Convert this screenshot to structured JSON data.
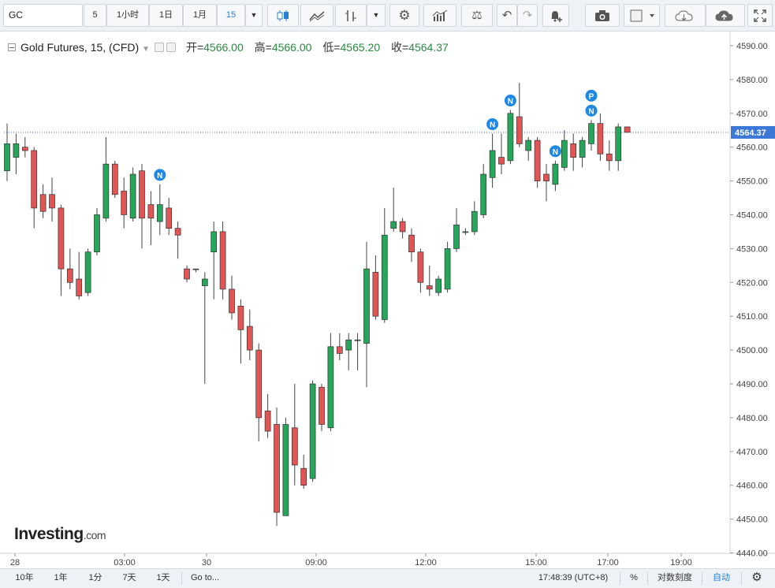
{
  "toolbar": {
    "symbol": "GC",
    "intervals": [
      "5",
      "1小时",
      "1日",
      "1月",
      "15"
    ],
    "active_interval": "15",
    "icons": [
      "dropdown-caret-icon",
      "candles-icon",
      "area-chart-icon",
      "bar-type-icon",
      "dropdown-caret-icon",
      "settings-gear-icon",
      "indicators-icon",
      "compare-scale-icon",
      "undo-icon",
      "redo-icon",
      "alert-bell-icon",
      "camera-icon",
      "color-square-icon",
      "dropdown-caret-icon",
      "cloud-download-icon",
      "cloud-upload-icon",
      "fullscreen-icon"
    ]
  },
  "legend": {
    "title": "Gold Futures, 15, (CFD)",
    "open_label": "开=",
    "open": "4566.00",
    "high_label": "高=",
    "high": "4566.00",
    "low_label": "低=",
    "low": "4565.20",
    "close_label": "收=",
    "close": "4564.37"
  },
  "price_axis": {
    "ticks": [
      "4590.00",
      "4580.00",
      "4570.00",
      "4560.00",
      "4550.00",
      "4540.00",
      "4530.00",
      "4520.00",
      "4510.00",
      "4500.00",
      "4490.00",
      "4480.00",
      "4470.00",
      "4460.00",
      "4450.00",
      "4440.00"
    ],
    "last_price": "4564.37",
    "last_price_color": "#3c78d8"
  },
  "time_axis": {
    "ticks": [
      "28",
      "03:00",
      "30",
      "09:00",
      "12:00",
      "15:00",
      "17:00",
      "19:00"
    ]
  },
  "logo": {
    "brand": "Investing",
    "suffix": ".com"
  },
  "bottombar": {
    "ranges": [
      "10年",
      "1年",
      "1分",
      "7天",
      "1天"
    ],
    "goto": "Go to...",
    "time": "17:48:39 (UTC+8)",
    "percent": "%",
    "log_scale": "对数刻度",
    "auto": "自动",
    "settings_icon": "gear-icon"
  },
  "colors": {
    "up": "#26a65b",
    "down": "#e15554",
    "accent": "#2a7fd4",
    "marker": "#1e88e5"
  },
  "chart_data": {
    "type": "candlestick",
    "title": "Gold Futures, 15, (CFD)",
    "ylim": [
      4440,
      4590
    ],
    "yticks": [
      4440,
      4450,
      4460,
      4470,
      4480,
      4490,
      4500,
      4510,
      4520,
      4530,
      4540,
      4550,
      4560,
      4570,
      4580,
      4590
    ],
    "xtick_labels": [
      "28",
      "03:00",
      "30",
      "09:00",
      "12:00",
      "15:00",
      "17:00",
      "19:00"
    ],
    "last_price": 4564.37,
    "candles": [
      {
        "o": 4553,
        "h": 4567,
        "l": 4550,
        "c": 4561
      },
      {
        "o": 4557,
        "h": 4564,
        "l": 4552,
        "c": 4561
      },
      {
        "o": 4560,
        "h": 4563,
        "l": 4557,
        "c": 4559
      },
      {
        "o": 4559,
        "h": 4560,
        "l": 4536,
        "c": 4542
      },
      {
        "o": 4546,
        "h": 4549,
        "l": 4539,
        "c": 4541
      },
      {
        "o": 4546,
        "h": 4551,
        "l": 4538,
        "c": 4542
      },
      {
        "o": 4542,
        "h": 4543,
        "l": 4516,
        "c": 4524
      },
      {
        "o": 4524,
        "h": 4530,
        "l": 4518,
        "c": 4520
      },
      {
        "o": 4521,
        "h": 4529,
        "l": 4515,
        "c": 4516
      },
      {
        "o": 4517,
        "h": 4530,
        "l": 4516,
        "c": 4529
      },
      {
        "o": 4529,
        "h": 4542,
        "l": 4528,
        "c": 4540
      },
      {
        "o": 4539,
        "h": 4563,
        "l": 4538,
        "c": 4555
      },
      {
        "o": 4555,
        "h": 4556,
        "l": 4545,
        "c": 4546
      },
      {
        "o": 4547,
        "h": 4551,
        "l": 4536,
        "c": 4540
      },
      {
        "o": 4539,
        "h": 4554,
        "l": 4538,
        "c": 4552
      },
      {
        "o": 4553,
        "h": 4555,
        "l": 4530,
        "c": 4539
      },
      {
        "o": 4543,
        "h": 4547,
        "l": 4531,
        "c": 4539
      },
      {
        "o": 4538,
        "h": 4549,
        "l": 4534,
        "c": 4543
      },
      {
        "o": 4542,
        "h": 4545,
        "l": 4534,
        "c": 4536
      },
      {
        "o": 4536,
        "h": 4538,
        "l": 4527,
        "c": 4534
      },
      {
        "o": 4524,
        "h": 4525,
        "l": 4520,
        "c": 4521
      },
      {
        "o": 4524,
        "h": 4524,
        "l": 4523,
        "c": 4524
      },
      {
        "o": 4519,
        "h": 4523,
        "l": 4490,
        "c": 4521
      },
      {
        "o": 4529,
        "h": 4538,
        "l": 4515,
        "c": 4535
      },
      {
        "o": 4535,
        "h": 4538,
        "l": 4515,
        "c": 4518
      },
      {
        "o": 4518,
        "h": 4522,
        "l": 4509,
        "c": 4511
      },
      {
        "o": 4513,
        "h": 4515,
        "l": 4496,
        "c": 4506
      },
      {
        "o": 4507,
        "h": 4512,
        "l": 4497,
        "c": 4500
      },
      {
        "o": 4500,
        "h": 4502,
        "l": 4473,
        "c": 4480
      },
      {
        "o": 4482,
        "h": 4487,
        "l": 4474,
        "c": 4476
      },
      {
        "o": 4478,
        "h": 4483,
        "l": 4448,
        "c": 4452
      },
      {
        "o": 4451,
        "h": 4480,
        "l": 4451,
        "c": 4478
      },
      {
        "o": 4477,
        "h": 4490,
        "l": 4460,
        "c": 4466
      },
      {
        "o": 4465,
        "h": 4469,
        "l": 4459,
        "c": 4460
      },
      {
        "o": 4462,
        "h": 4491,
        "l": 4461,
        "c": 4490
      },
      {
        "o": 4489,
        "h": 4490,
        "l": 4476,
        "c": 4478
      },
      {
        "o": 4477,
        "h": 4505,
        "l": 4476,
        "c": 4501
      },
      {
        "o": 4501,
        "h": 4505,
        "l": 4497,
        "c": 4499
      },
      {
        "o": 4500,
        "h": 4505,
        "l": 4494,
        "c": 4503
      },
      {
        "o": 4503,
        "h": 4505,
        "l": 4494,
        "c": 4503
      },
      {
        "o": 4502,
        "h": 4532,
        "l": 4489,
        "c": 4524
      },
      {
        "o": 4523,
        "h": 4528,
        "l": 4509,
        "c": 4510
      },
      {
        "o": 4509,
        "h": 4542,
        "l": 4508,
        "c": 4534
      },
      {
        "o": 4536,
        "h": 4548,
        "l": 4535,
        "c": 4538
      },
      {
        "o": 4538,
        "h": 4539,
        "l": 4533,
        "c": 4535
      },
      {
        "o": 4534,
        "h": 4536,
        "l": 4526,
        "c": 4529
      },
      {
        "o": 4529,
        "h": 4530,
        "l": 4517,
        "c": 4520
      },
      {
        "o": 4519,
        "h": 4525,
        "l": 4516,
        "c": 4518
      },
      {
        "o": 4517,
        "h": 4522,
        "l": 4516,
        "c": 4521
      },
      {
        "o": 4518,
        "h": 4532,
        "l": 4517,
        "c": 4530
      },
      {
        "o": 4530,
        "h": 4542,
        "l": 4529,
        "c": 4537
      },
      {
        "o": 4535,
        "h": 4536,
        "l": 4534,
        "c": 4535
      },
      {
        "o": 4535,
        "h": 4544,
        "l": 4534,
        "c": 4541
      },
      {
        "o": 4540,
        "h": 4555,
        "l": 4539,
        "c": 4552
      },
      {
        "o": 4551,
        "h": 4564,
        "l": 4548,
        "c": 4559
      },
      {
        "o": 4557,
        "h": 4564,
        "l": 4552,
        "c": 4555
      },
      {
        "o": 4556,
        "h": 4571,
        "l": 4555,
        "c": 4570
      },
      {
        "o": 4569,
        "h": 4579,
        "l": 4560,
        "c": 4561
      },
      {
        "o": 4559,
        "h": 4563,
        "l": 4556,
        "c": 4562
      },
      {
        "o": 4562,
        "h": 4563,
        "l": 4548,
        "c": 4550
      },
      {
        "o": 4552,
        "h": 4555,
        "l": 4544,
        "c": 4550
      },
      {
        "o": 4549,
        "h": 4556,
        "l": 4547,
        "c": 4555
      },
      {
        "o": 4554,
        "h": 4565,
        "l": 4553,
        "c": 4562
      },
      {
        "o": 4561,
        "h": 4564,
        "l": 4553,
        "c": 4557
      },
      {
        "o": 4557,
        "h": 4563,
        "l": 4554,
        "c": 4562
      },
      {
        "o": 4561,
        "h": 4568,
        "l": 4559,
        "c": 4567
      },
      {
        "o": 4567,
        "h": 4570,
        "l": 4556,
        "c": 4558
      },
      {
        "o": 4558,
        "h": 4562,
        "l": 4553,
        "c": 4556
      },
      {
        "o": 4556,
        "h": 4567,
        "l": 4553,
        "c": 4566
      },
      {
        "o": 4566,
        "h": 4566,
        "l": 4565,
        "c": 4564.37
      }
    ],
    "markers": [
      {
        "label": "N",
        "candle": 17
      },
      {
        "label": "N",
        "candle": 54
      },
      {
        "label": "N",
        "candle": 56
      },
      {
        "label": "N",
        "candle": 61
      },
      {
        "label": "N",
        "candle": 65
      },
      {
        "label": "P",
        "candle": 65
      }
    ]
  }
}
